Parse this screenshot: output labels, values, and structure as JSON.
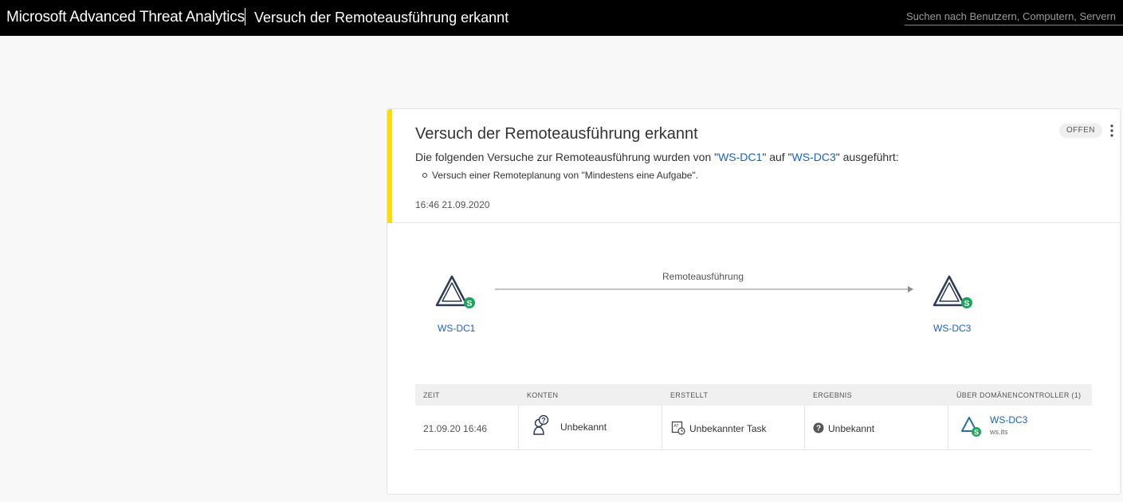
{
  "app": {
    "title": "Microsoft Advanced Threat Analytics",
    "page_title": "Versuch der Remoteausführung erkannt",
    "search_placeholder": "Suchen nach Benutzern, Computern, Servern"
  },
  "alert": {
    "title": "Versuch der Remoteausführung erkannt",
    "status": "OFFEN",
    "more_icon": "vertical-ellipsis-icon",
    "description": {
      "prefix": "Die folgenden Versuche zur Remoteausführung wurden von \"",
      "source": "WS-DC1",
      "middle": "\" auf \"",
      "target": "WS-DC3",
      "suffix": "\" ausgeführt:"
    },
    "bullet": "Versuch einer Remoteplanung von \"Mindestens eine Aufgabe\".",
    "timestamp": "16:46 21.09.2020",
    "accent_color": "#ffdd00",
    "link_color": "#1a64b8"
  },
  "diagram": {
    "source": {
      "label": "WS-DC1",
      "icon": "domain-controller-icon",
      "badge": "S"
    },
    "edge": {
      "label": "Remoteausführung"
    },
    "target": {
      "label": "WS-DC3",
      "icon": "domain-controller-icon",
      "badge": "S"
    },
    "badge_color": "#1fa45b"
  },
  "table": {
    "headers": [
      "ZEIT",
      "KONTEN",
      "ERSTELLT",
      "ERGEBNIS",
      "ÜBER DOMÄNENCONTROLLER (1)"
    ],
    "rows": [
      {
        "time": "21.09.20 16:46",
        "account": "Unbekannt",
        "account_icon": "unknown-user-icon",
        "created": "Unbekannter Task",
        "created_icon": "scheduled-task-icon",
        "result": "Unbekannt",
        "result_icon": "question-circle-icon",
        "dc_name": "WS-DC3",
        "dc_domain": "ws.its",
        "dc_icon": "domain-controller-icon",
        "dc_badge": "S"
      }
    ]
  }
}
